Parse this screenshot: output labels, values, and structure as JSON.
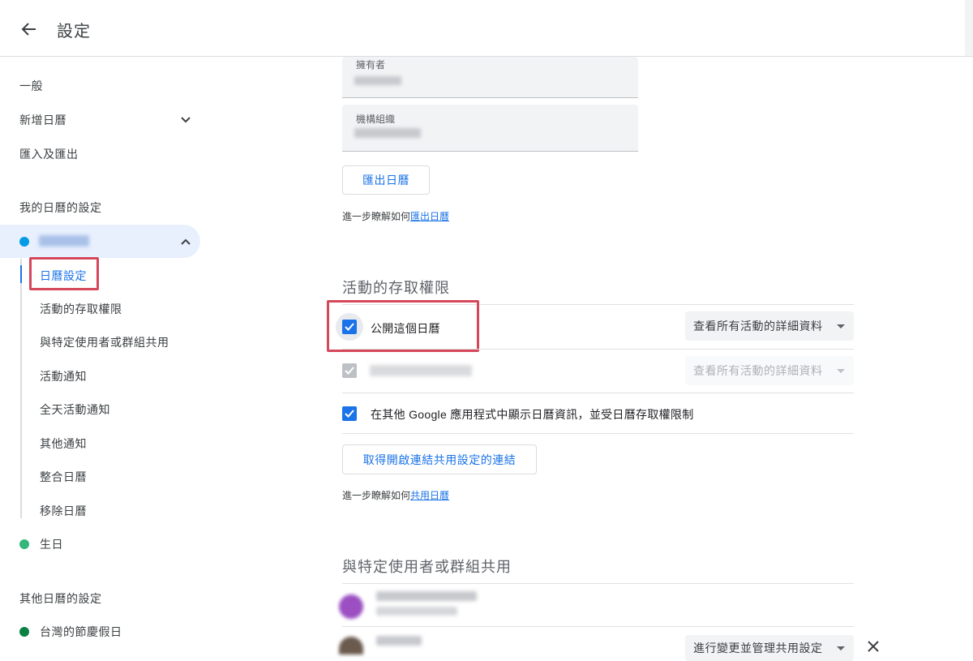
{
  "header": {
    "title": "設定",
    "back_icon": "arrow-back-icon"
  },
  "sidebar": {
    "general": "一般",
    "add_calendar": "新增日曆",
    "import_export": "匯入及匯出",
    "my_calendars_heading": "我的日曆的設定",
    "my_calendar_color": "#039be5",
    "sub_items": [
      "日曆設定",
      "活動的存取權限",
      "與特定使用者或群組共用",
      "活動通知",
      "全天活動通知",
      "其他通知",
      "整合日曆",
      "移除日曆"
    ],
    "birthday": "生日",
    "birthday_color": "#33b679",
    "other_calendars_heading": "其他日曆的設定",
    "holiday": "台灣的節慶假日",
    "holiday_color": "#0b8043"
  },
  "main": {
    "owner_label": "擁有者",
    "org_label": "機構組織",
    "export_button": "匯出日曆",
    "export_help_prefix": "進一步瞭解如何",
    "export_help_link": "匯出日曆",
    "access_title": "活動的存取權限",
    "public_label": "公開這個日曆",
    "public_select": "查看所有活動的詳細資料",
    "org_select": "查看所有活動的詳細資料",
    "google_apps_label": "在其他 Google 應用程式中顯示日曆資訊，並受日曆存取權限制",
    "share_link_button": "取得開啟連結共用設定的連結",
    "share_help_prefix": "進一步瞭解如何",
    "share_help_link": "共用日曆",
    "share_title": "與特定使用者或群組共用",
    "user_permission_select": "進行變更並管理共用設定"
  },
  "colors": {
    "accent": "#1a73e8",
    "highlight": "#d5475a"
  }
}
